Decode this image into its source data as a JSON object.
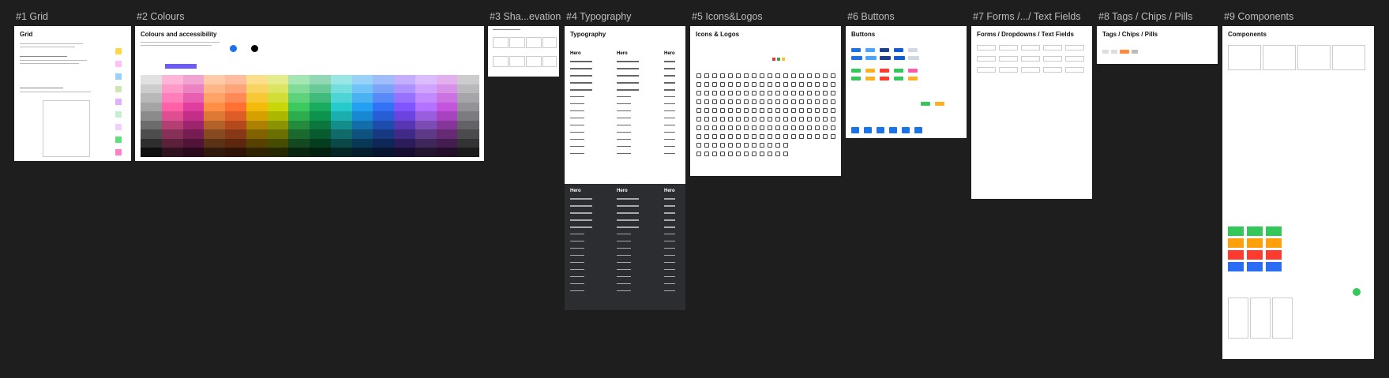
{
  "canvas": {
    "background": "#1e1e1e"
  },
  "frames": [
    {
      "id": "grid",
      "label": "#1 Grid",
      "title": "Grid"
    },
    {
      "id": "colours",
      "label": "#2 Colours",
      "title": "Colours and accessibility"
    },
    {
      "id": "shadow",
      "label": "#3 Sha...evation",
      "title": ""
    },
    {
      "id": "typography",
      "label": "#4 Typography",
      "title": "Typography",
      "hero": "Hero"
    },
    {
      "id": "icons",
      "label": "#5 Icons&Logos",
      "title": "Icons & Logos"
    },
    {
      "id": "buttons",
      "label": "#6 Buttons",
      "title": "Buttons"
    },
    {
      "id": "forms",
      "label": "#7 Forms  /.../  Text Fields",
      "title": "Forms / Dropdowns / Text Fields"
    },
    {
      "id": "tags",
      "label": "#8 Tags  /  Chips  /  Pills",
      "title": "Tags / Chips / Pills"
    },
    {
      "id": "components",
      "label": "#9 Components",
      "title": "Components"
    }
  ],
  "colors": {
    "palette": [
      "#f0f0f0",
      "#ff5aa5",
      "#e0359c",
      "#ff8a3d",
      "#ff6a2a",
      "#f5b800",
      "#c6d400",
      "#34c759",
      "#0fa958",
      "#1ec8c8",
      "#1a9cf0",
      "#2b6cf5",
      "#7b4dff",
      "#b06cff",
      "#c04ddb",
      "#8e8e93"
    ],
    "accent": "#1a73e8"
  }
}
